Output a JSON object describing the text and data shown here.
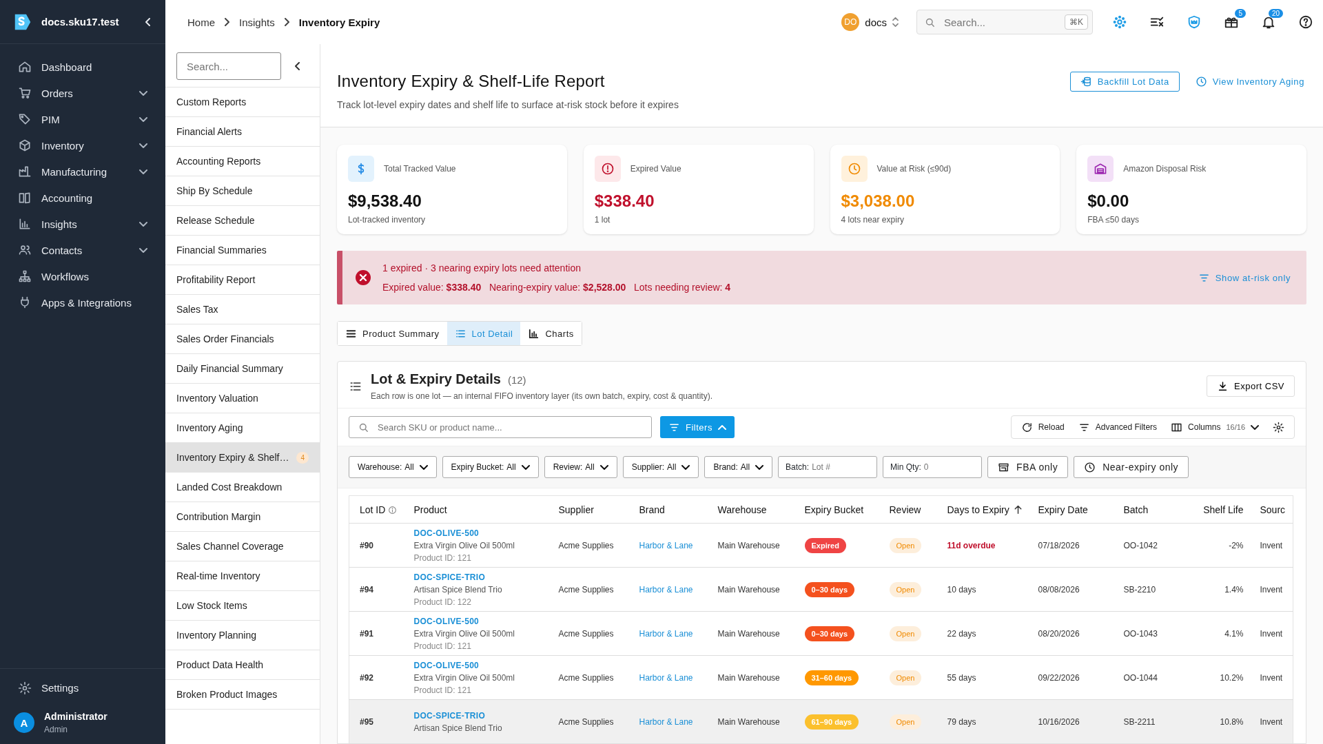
{
  "app": {
    "site": "docs.sku17.test",
    "user_name": "Administrator",
    "user_role": "Admin",
    "user_initial": "A"
  },
  "nav": [
    {
      "label": "Dashboard",
      "expandable": false
    },
    {
      "label": "Orders",
      "expandable": true
    },
    {
      "label": "PIM",
      "expandable": true
    },
    {
      "label": "Inventory",
      "expandable": true
    },
    {
      "label": "Manufacturing",
      "expandable": true
    },
    {
      "label": "Accounting",
      "expandable": false
    },
    {
      "label": "Insights",
      "expandable": true
    },
    {
      "label": "Contacts",
      "expandable": true
    },
    {
      "label": "Workflows",
      "expandable": false
    },
    {
      "label": "Apps & Integrations",
      "expandable": false
    }
  ],
  "settings_label": "Settings",
  "breadcrumb": [
    "Home",
    "Insights",
    "Inventory Expiry"
  ],
  "workspace": {
    "initials": "DO",
    "name": "docs"
  },
  "top_search": {
    "placeholder": "Search...",
    "shortcut": "⌘K"
  },
  "top_badges": {
    "gifts": "5",
    "notifications": "20"
  },
  "reports_panel": {
    "search_placeholder": "Search...",
    "items": [
      {
        "label": "Custom Reports",
        "selected": false
      },
      {
        "label": "Financial Alerts",
        "selected": false
      },
      {
        "label": "Accounting Reports",
        "selected": false
      },
      {
        "label": "Ship By Schedule",
        "selected": false
      },
      {
        "label": "Release Schedule",
        "selected": false
      },
      {
        "label": "Financial Summaries",
        "selected": false
      },
      {
        "label": "Profitability Report",
        "selected": false
      },
      {
        "label": "Sales Tax",
        "selected": false
      },
      {
        "label": "Sales Order Financials",
        "selected": false
      },
      {
        "label": "Daily Financial Summary",
        "selected": false
      },
      {
        "label": "Inventory Valuation",
        "selected": false
      },
      {
        "label": "Inventory Aging",
        "selected": false
      },
      {
        "label": "Inventory Expiry & Shelf…",
        "selected": true,
        "badge": "4"
      },
      {
        "label": "Landed Cost Breakdown",
        "selected": false
      },
      {
        "label": "Contribution Margin",
        "selected": false
      },
      {
        "label": "Sales Channel Coverage",
        "selected": false
      },
      {
        "label": "Real-time Inventory",
        "selected": false
      },
      {
        "label": "Low Stock Items",
        "selected": false
      },
      {
        "label": "Inventory Planning",
        "selected": false
      },
      {
        "label": "Product Data Health",
        "selected": false
      },
      {
        "label": "Broken Product Images",
        "selected": false
      }
    ]
  },
  "page": {
    "title": "Inventory Expiry & Shelf-Life Report",
    "subtitle": "Track lot-level expiry dates and shelf life to surface at-risk stock before it expires",
    "actions": [
      "Backfill Lot Data",
      "View Inventory Aging"
    ]
  },
  "cards": [
    {
      "kind": "dollar",
      "label": "Total Tracked Value",
      "value": "$9,538.40",
      "note": "Lot-tracked inventory",
      "color": "#111111"
    },
    {
      "kind": "alert",
      "label": "Expired Value",
      "value": "$338.40",
      "note": "1 lot",
      "color": "#c0102c"
    },
    {
      "kind": "clock",
      "label": "Value at Risk (≤90d)",
      "value": "$3,038.00",
      "note": "4 lots near expiry",
      "color": "#f08a00"
    },
    {
      "kind": "warehouse",
      "label": "Amazon Disposal Risk",
      "value": "$0.00",
      "note": "FBA ≤50 days",
      "color": "#111111"
    }
  ],
  "alert": {
    "headline": "1 expired · 3 nearing expiry lots need attention",
    "details": "Expired value: **$338.40**   Nearing-expiry value: **$2,528.00**   Lots needing review: **4**",
    "action": "Show at-risk only"
  },
  "tabs": [
    {
      "label": "Product Summary",
      "selected": false
    },
    {
      "label": "Lot Detail",
      "selected": true
    },
    {
      "label": "Charts",
      "selected": false
    }
  ],
  "section": {
    "title": "Lot & Expiry Details",
    "count": "(12)",
    "description": "Each row is one lot — an internal FIFO inventory layer (its own batch, expiry, cost & quantity).",
    "export": "Export CSV"
  },
  "toolbar": {
    "search_placeholder": "Search SKU or product name...",
    "filters": "Filters",
    "reload": "Reload",
    "advanced": "Advanced Filters",
    "columns": "Columns",
    "columns_count": "16/16"
  },
  "filters": [
    {
      "kind": "select",
      "label": "Warehouse:",
      "value": "All"
    },
    {
      "kind": "select",
      "label": "Expiry Bucket:",
      "value": "All"
    },
    {
      "kind": "select",
      "label": "Review:",
      "value": "All"
    },
    {
      "kind": "select",
      "label": "Supplier:",
      "value": "All"
    },
    {
      "kind": "select",
      "label": "Brand:",
      "value": "All"
    },
    {
      "kind": "input",
      "label": "Batch:",
      "placeholder": "Lot #"
    },
    {
      "kind": "input",
      "label": "Min Qty:",
      "placeholder": "0"
    },
    {
      "kind": "toggle",
      "label": "FBA only",
      "on": false
    },
    {
      "kind": "toggle",
      "label": "Near-expiry only",
      "on": false
    }
  ],
  "table": {
    "columns": [
      "Lot ID",
      "Product",
      "Supplier",
      "Brand",
      "Warehouse",
      "Expiry Bucket",
      "Review",
      "Days to Expiry",
      "Expiry Date",
      "Batch",
      "Shelf Life",
      "Sourc"
    ],
    "rows": [
      {
        "lot": "#90",
        "sku": "DOC-OLIVE-500",
        "name": "Extra Virgin Olive Oil 500ml",
        "product_id": "Product ID: 121",
        "supplier": "Acme Supplies",
        "brand": "Harbor & Lane",
        "warehouse": "Main Warehouse",
        "bucket": "Expired",
        "color": "#ef4444",
        "review": "Open",
        "days": "11d overdue",
        "overdue": true,
        "date": "07/18/2026",
        "batch": "OO-1042",
        "shelf": "-2%",
        "source": "Invent",
        "selected": false
      },
      {
        "lot": "#94",
        "sku": "DOC-SPICE-TRIO",
        "name": "Artisan Spice Blend Trio",
        "product_id": "Product ID: 122",
        "supplier": "Acme Supplies",
        "brand": "Harbor & Lane",
        "warehouse": "Main Warehouse",
        "bucket": "0–30 days",
        "color": "#f4511e",
        "review": "Open",
        "days": "10 days",
        "overdue": false,
        "date": "08/08/2026",
        "batch": "SB-2210",
        "shelf": "1.4%",
        "source": "Invent",
        "selected": false
      },
      {
        "lot": "#91",
        "sku": "DOC-OLIVE-500",
        "name": "Extra Virgin Olive Oil 500ml",
        "product_id": "Product ID: 121",
        "supplier": "Acme Supplies",
        "brand": "Harbor & Lane",
        "warehouse": "Main Warehouse",
        "bucket": "0–30 days",
        "color": "#f4511e",
        "review": "Open",
        "days": "22 days",
        "overdue": false,
        "date": "08/20/2026",
        "batch": "OO-1043",
        "shelf": "4.1%",
        "source": "Invent",
        "selected": false
      },
      {
        "lot": "#92",
        "sku": "DOC-OLIVE-500",
        "name": "Extra Virgin Olive Oil 500ml",
        "product_id": "Product ID: 121",
        "supplier": "Acme Supplies",
        "brand": "Harbor & Lane",
        "warehouse": "Main Warehouse",
        "bucket": "31–60 days",
        "color": "#ff9800",
        "review": "Open",
        "days": "55 days",
        "overdue": false,
        "date": "09/22/2026",
        "batch": "OO-1044",
        "shelf": "10.2%",
        "source": "Invent",
        "selected": false
      },
      {
        "lot": "#95",
        "sku": "DOC-SPICE-TRIO",
        "name": "Artisan Spice Blend Trio",
        "supplier": "Acme Supplies",
        "brand": "Harbor & Lane",
        "warehouse": "Main Warehouse",
        "bucket": "61–90 days",
        "color": "#fbc02d",
        "review": "Open",
        "days": "79 days",
        "overdue": false,
        "date": "10/16/2026",
        "batch": "SB-2211",
        "shelf": "10.8%",
        "source": "Invent",
        "selected": true
      }
    ]
  }
}
